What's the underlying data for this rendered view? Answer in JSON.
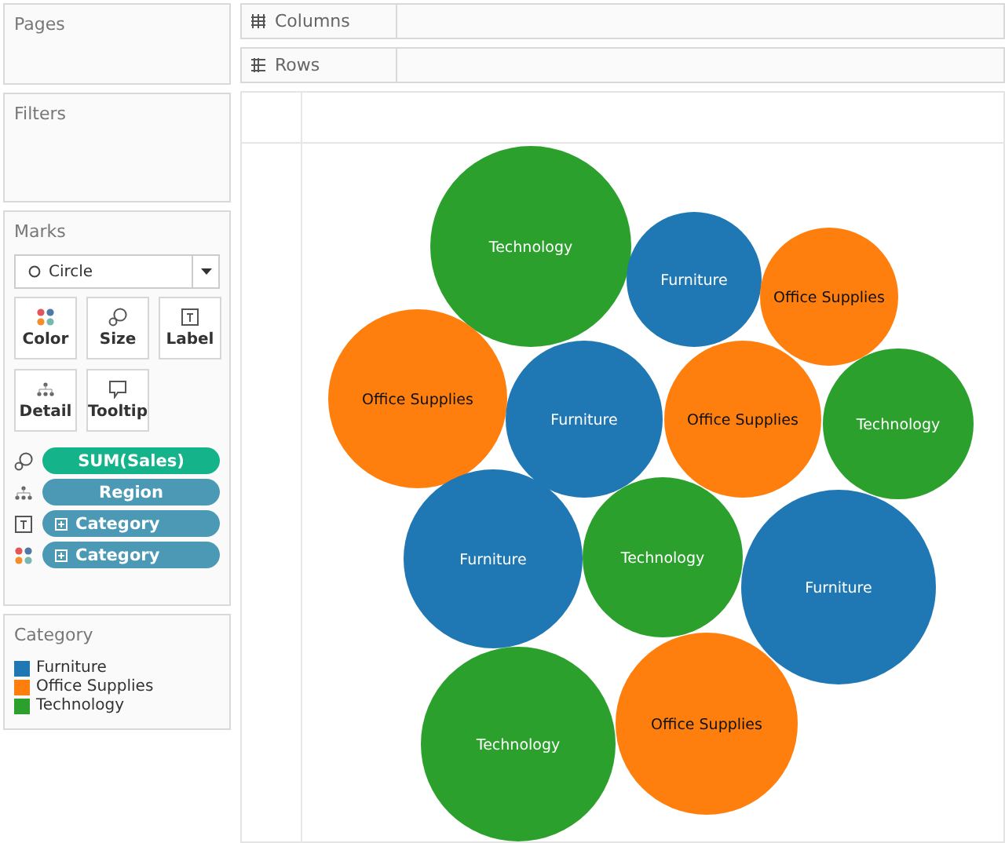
{
  "pages": {
    "title": "Pages"
  },
  "filters": {
    "title": "Filters"
  },
  "marks": {
    "title": "Marks",
    "mark_type": "Circle",
    "buttons": [
      {
        "kind": "color",
        "label": "Color"
      },
      {
        "kind": "size",
        "label": "Size"
      },
      {
        "kind": "label",
        "label": "Label"
      },
      {
        "kind": "detail",
        "label": "Detail"
      },
      {
        "kind": "tooltip",
        "label": "Tooltip"
      }
    ],
    "pills": [
      {
        "kind": "size",
        "label": "SUM(Sales)",
        "measure": true,
        "expand": false
      },
      {
        "kind": "detail",
        "label": "Region",
        "measure": false,
        "expand": false
      },
      {
        "kind": "label",
        "label": "Category",
        "measure": false,
        "expand": true
      },
      {
        "kind": "color",
        "label": "Category",
        "measure": false,
        "expand": true
      }
    ]
  },
  "legend": {
    "title": "Category",
    "items": [
      {
        "label": "Furniture",
        "color": "#1f77b4"
      },
      {
        "label": "Office Supplies",
        "color": "#ff7f0e"
      },
      {
        "label": "Technology",
        "color": "#2ca02c"
      }
    ]
  },
  "shelves": [
    {
      "kind": "columns",
      "label": "Columns"
    },
    {
      "kind": "rows",
      "label": "Rows"
    }
  ],
  "bubbles": [
    {
      "label": "Technology",
      "color": "#2ca02c"
    },
    {
      "label": "Furniture",
      "color": "#1f77b4"
    },
    {
      "label": "Office Supplies",
      "color": "#ff7f0e"
    },
    {
      "label": "Office Supplies",
      "color": "#ff7f0e"
    },
    {
      "label": "Furniture",
      "color": "#1f77b4"
    },
    {
      "label": "Office Supplies",
      "color": "#ff7f0e"
    },
    {
      "label": "Technology",
      "color": "#2ca02c"
    },
    {
      "label": "Furniture",
      "color": "#1f77b4"
    },
    {
      "label": "Technology",
      "color": "#2ca02c"
    },
    {
      "label": "Furniture",
      "color": "#1f77b4"
    },
    {
      "label": "Technology",
      "color": "#2ca02c"
    },
    {
      "label": "Office Supplies",
      "color": "#ff7f0e"
    }
  ]
}
